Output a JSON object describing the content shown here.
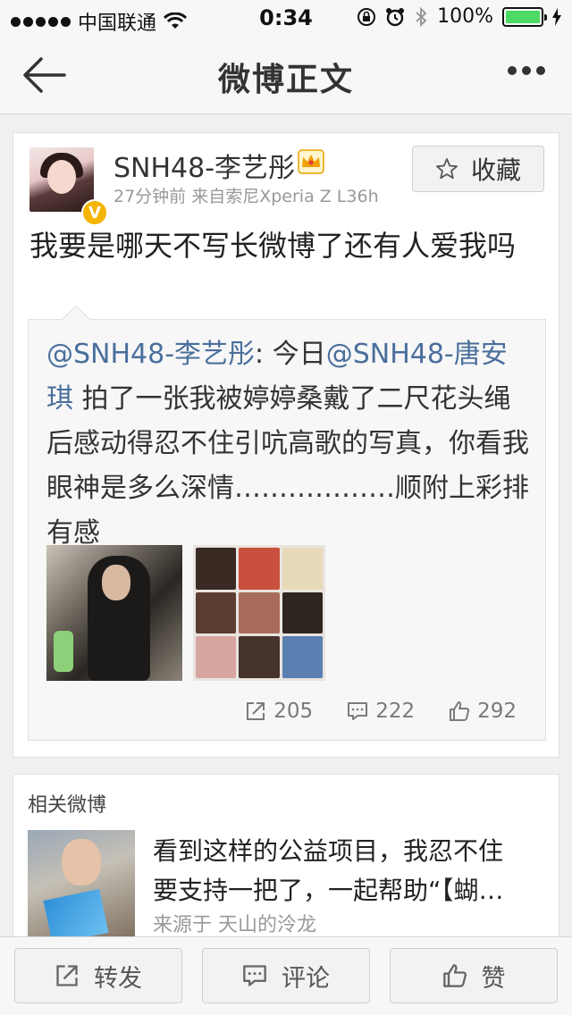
{
  "status_bar": {
    "carrier": "中国联通",
    "time": "0:34",
    "battery": "100%",
    "battery_level": 1.0
  },
  "nav": {
    "title": "微博正文"
  },
  "post": {
    "username": "SNH48-李艺彤",
    "meta": "27分钟前   来自索尼Xperia Z L36h",
    "favorite_label": "收藏",
    "verified_badge": "V",
    "text": "我要是哪天不写长微博了还有人爱我吗",
    "repost": {
      "author_mention": "@SNH48-李艺彤",
      "colon": ": 今日",
      "mention2": "@SNH48-唐安琪",
      "body": " 拍了一张我被婷婷桑戴了二尺花头绳后感动得忍不住引吭高歌的写真，你看我眼神是多么深情………………顺附上彩排有感"
    },
    "stats": {
      "reposts": "205",
      "comments": "222",
      "likes": "292"
    }
  },
  "related": {
    "title": "相关微博",
    "text_line1": "看到这样的公益项目，我忍不住",
    "text_line2": "要支持一把了，一起帮助“【蝴…",
    "source": "来源于 天山的泠龙"
  },
  "toolbar": {
    "repost_label": "转发",
    "comment_label": "评论",
    "like_label": "赞"
  },
  "colors": {
    "mention": "#4a6f9c",
    "battery_green": "#4cd964",
    "badge_gold": "#f5b400"
  },
  "icons": [
    "back-arrow-icon",
    "more-icon",
    "star-icon",
    "crown-icon",
    "repost-icon",
    "comment-icon",
    "like-icon",
    "wifi-icon",
    "lock-icon",
    "alarm-icon",
    "bluetooth-icon",
    "charging-icon"
  ]
}
